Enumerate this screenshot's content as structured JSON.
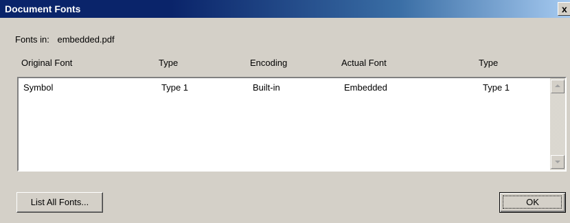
{
  "window": {
    "title": "Document Fonts",
    "close_label": "x"
  },
  "fonts_in": {
    "label": "Fonts in:",
    "file": "embedded.pdf"
  },
  "columns": [
    "Original Font",
    "Type",
    "Encoding",
    "Actual Font",
    "Type"
  ],
  "rows": [
    {
      "original_font": "Symbol",
      "type": "Type 1",
      "encoding": "Built-in",
      "actual_font": "Embedded",
      "actual_type": "Type 1"
    }
  ],
  "buttons": {
    "list_all": "List All Fonts...",
    "ok": "OK"
  },
  "colors": {
    "titlebar_start": "#0a246a",
    "titlebar_end": "#a6caf0",
    "dialog_bg": "#d4d0c8"
  }
}
